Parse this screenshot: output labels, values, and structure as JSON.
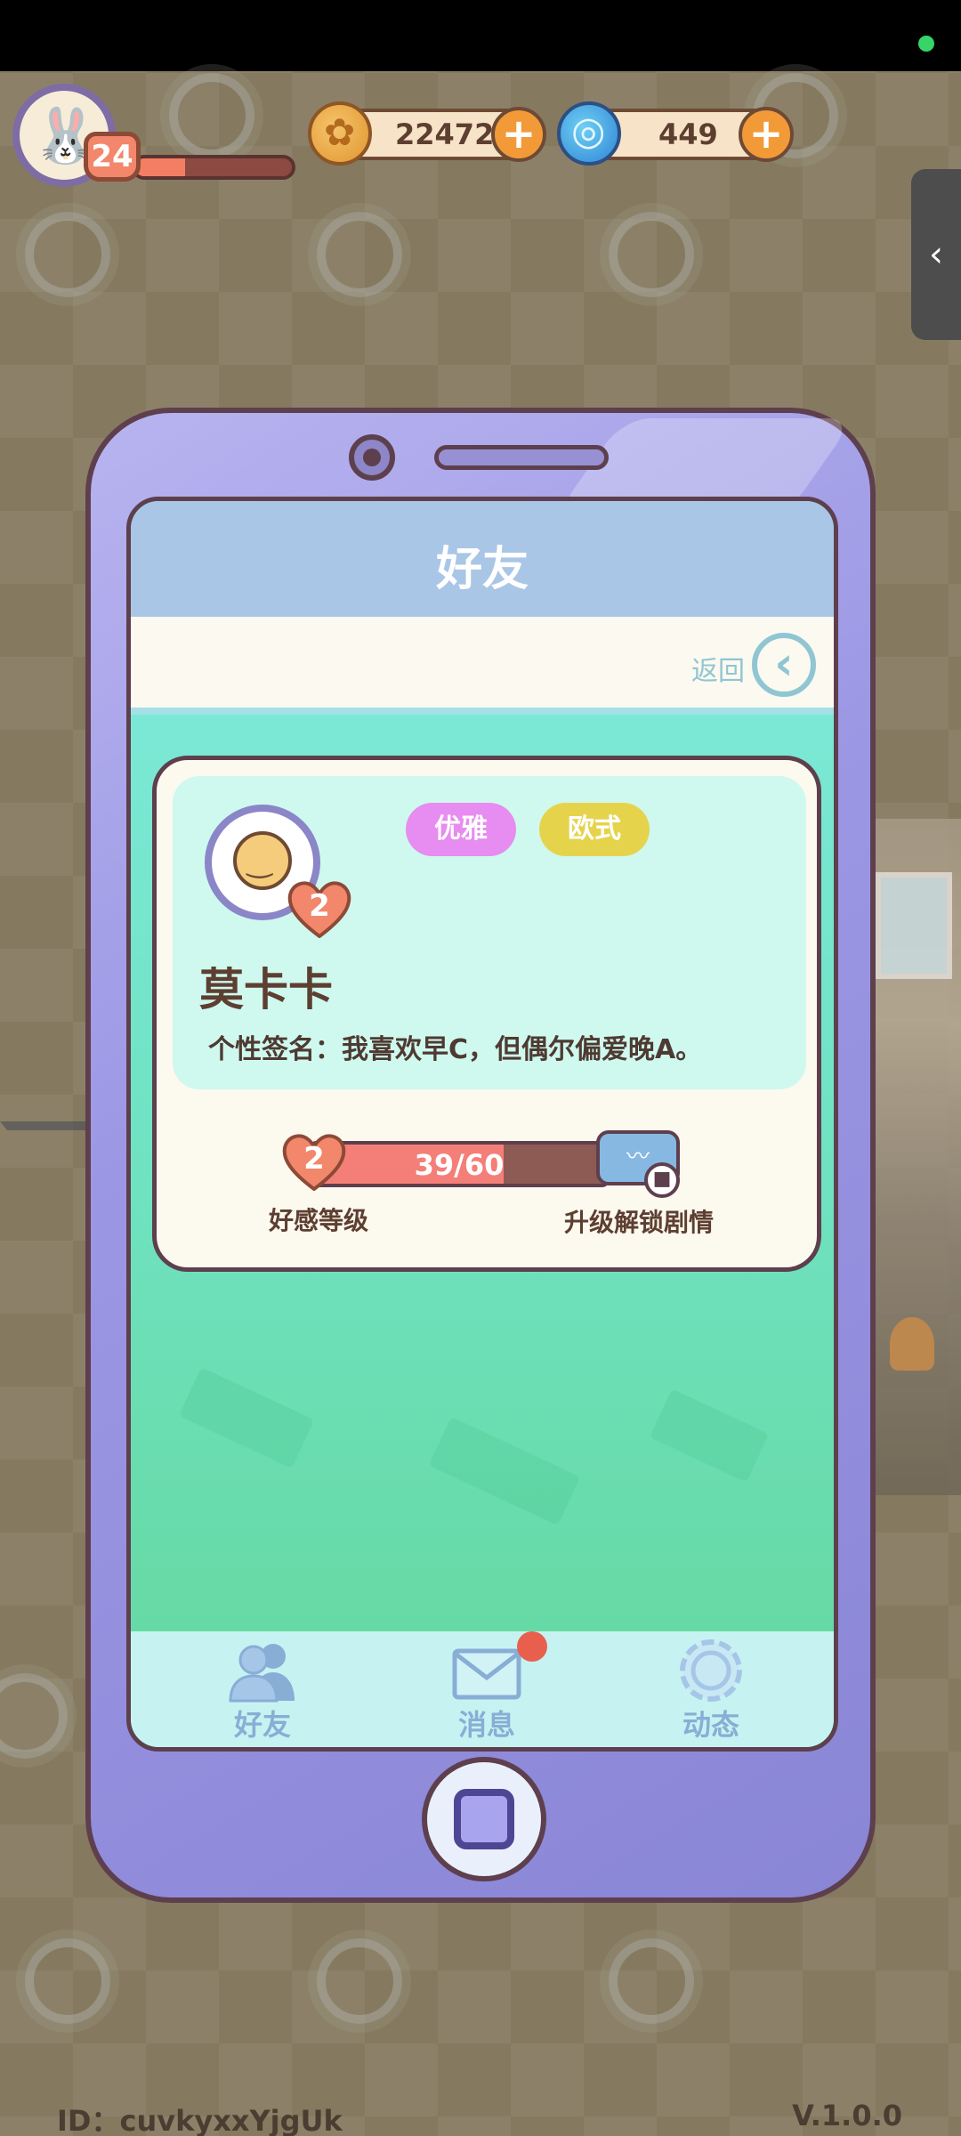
{
  "hud": {
    "player_level": "24",
    "xp_fraction": 0.32,
    "coins": "22472",
    "gems": "449"
  },
  "phone": {
    "title": "好友",
    "back_label": "返回",
    "back_icon": "chevron-left-icon",
    "friend": {
      "name": "莫卡卡",
      "heart_level": "2",
      "tags": [
        "优雅",
        "欧式"
      ],
      "signature": "个性签名：我喜欢早C，但偶尔偏爱晚A。",
      "affinity_progress": "39/60",
      "affinity_fraction": 0.65,
      "affinity_label": "好感等级",
      "unlock_label": "升级解锁剧情"
    },
    "tabs": [
      {
        "label": "好友",
        "icon": "friends-icon"
      },
      {
        "label": "消息",
        "icon": "mail-icon",
        "has_badge": true
      },
      {
        "label": "动态",
        "icon": "feed-icon"
      }
    ]
  },
  "footer": {
    "id_text": "ID：cuvkyxxYjgUk",
    "version": "V.1.0.0"
  },
  "colors": {
    "accent_orange": "#f29a38",
    "heart_coral": "#f2876b",
    "tag_pink": "#e78cf0",
    "tag_yellow": "#e6d34c"
  }
}
